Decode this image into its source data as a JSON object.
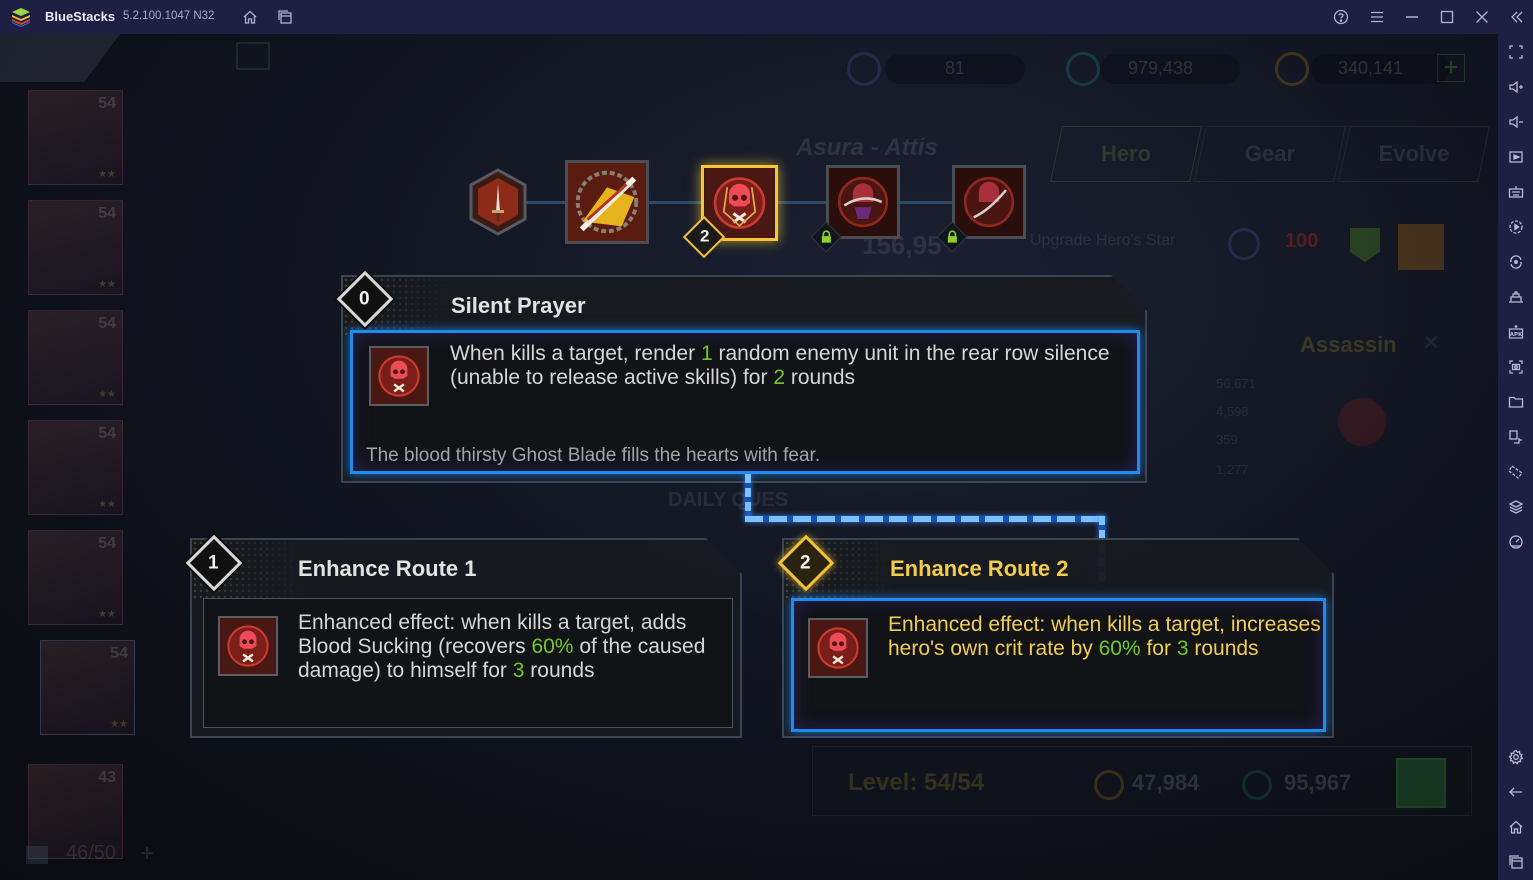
{
  "window": {
    "app_name": "BlueStacks",
    "version": "5.2.100.1047 N32",
    "titlebar_buttons": [
      "home-icon",
      "multi-instance-icon",
      "help-icon",
      "menu-icon",
      "minimize-icon",
      "maximize-icon",
      "close-icon",
      "collapse-sidebar-icon"
    ]
  },
  "sidebar": {
    "top_tools": [
      "fullscreen",
      "volume-up",
      "volume-down",
      "screen-record",
      "keyboard-controls",
      "macro-recorder",
      "sync-instances",
      "game-controls",
      "install-apk",
      "screenshot",
      "media-folder",
      "multi-instance",
      "rotate",
      "layers",
      "eco-mode"
    ],
    "bottom_tools": [
      "settings",
      "back",
      "home",
      "recent-apps"
    ]
  },
  "background": {
    "currencies": [
      {
        "icon": "star-badge-icon",
        "value": "81"
      },
      {
        "icon": "exp-coin-icon",
        "value": "979,438"
      },
      {
        "icon": "gold-coin-icon",
        "value": "340,141"
      }
    ],
    "hero_name": "Asura - Attis",
    "tabs": [
      "Hero",
      "Gear",
      "Evolve"
    ],
    "power_value": "156,95",
    "upgrade_label": "Upgrade Hero's Star",
    "upgrade_cost": "100",
    "class_label": "Assassin",
    "stats": [
      "56,671",
      "4,598",
      "359",
      "1,277"
    ],
    "daily_label": "DAILY QUES",
    "level_label": "Level:",
    "level_value": "54/54",
    "level_costs": [
      "47,984",
      "95,967"
    ],
    "hero_list": [
      {
        "level": "54",
        "stars": "★★"
      },
      {
        "level": "54",
        "stars": "★★"
      },
      {
        "level": "54",
        "stars": "★★"
      },
      {
        "level": "54",
        "stars": "★★"
      },
      {
        "level": "54",
        "stars": "★★"
      },
      {
        "level": "54",
        "stars": "★★"
      },
      {
        "level": "43",
        "stars": ""
      }
    ],
    "hero_count": "46/50"
  },
  "skill_path": {
    "nodes": [
      {
        "name": "dagger-skill",
        "state": "unlocked"
      },
      {
        "name": "chain-blade-skill",
        "state": "unlocked"
      },
      {
        "name": "silent-prayer-skill",
        "state": "selected",
        "badge": "2"
      },
      {
        "name": "locked-skill-4",
        "state": "locked"
      },
      {
        "name": "locked-skill-5",
        "state": "locked"
      }
    ]
  },
  "main_skill": {
    "badge": "0",
    "title": "Silent Prayer",
    "desc_parts": [
      "When kills a target, render ",
      "1",
      " random enemy unit in the rear row silence (unable to release active skills) for ",
      "2",
      " rounds"
    ],
    "flavor": "The blood thirsty Ghost Blade fills the hearts with fear."
  },
  "routes": [
    {
      "badge": "1",
      "title": "Enhance Route 1",
      "selected": false,
      "desc_parts": [
        "Enhanced effect: when kills a target, adds Blood Sucking (recovers ",
        "60%",
        " of the caused damage) to himself for ",
        "3",
        " rounds"
      ]
    },
    {
      "badge": "2",
      "title": "Enhance Route 2",
      "selected": true,
      "desc_parts": [
        "Enhanced effect: when kills a target, increases hero's own crit rate by ",
        "60%",
        " for ",
        "3",
        " rounds"
      ]
    }
  ],
  "colors": {
    "highlight_green": "#6fc92a",
    "selected_gold": "#f3cc4a",
    "selected_blue": "#1d8cf0",
    "chrome_bg": "#1d2043"
  }
}
